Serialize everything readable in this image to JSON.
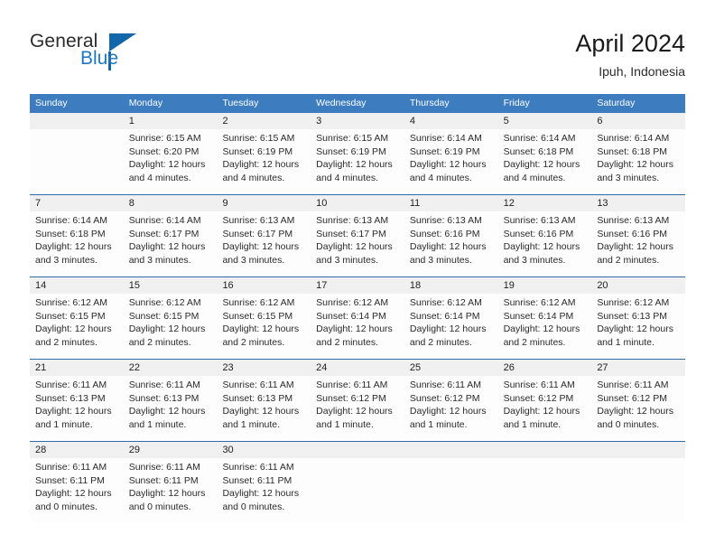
{
  "brand": {
    "name_part1": "General",
    "name_part2": "Blue",
    "accent_color": "#1366a8",
    "triangle_icon": "brand-triangle-icon"
  },
  "header": {
    "title": "April 2024",
    "subtitle": "Ipuh, Indonesia"
  },
  "calendar": {
    "header_bg": "#3d7dbf",
    "number_band_bg": "#f0f0f0",
    "week_divider_color": "#2f6ca8",
    "day_names": [
      "Sunday",
      "Monday",
      "Tuesday",
      "Wednesday",
      "Thursday",
      "Friday",
      "Saturday"
    ],
    "weeks": [
      {
        "days": [
          {
            "date": "",
            "lines": []
          },
          {
            "date": "1",
            "lines": [
              "Sunrise: 6:15 AM",
              "Sunset: 6:20 PM",
              "Daylight: 12 hours",
              "and 4 minutes."
            ]
          },
          {
            "date": "2",
            "lines": [
              "Sunrise: 6:15 AM",
              "Sunset: 6:19 PM",
              "Daylight: 12 hours",
              "and 4 minutes."
            ]
          },
          {
            "date": "3",
            "lines": [
              "Sunrise: 6:15 AM",
              "Sunset: 6:19 PM",
              "Daylight: 12 hours",
              "and 4 minutes."
            ]
          },
          {
            "date": "4",
            "lines": [
              "Sunrise: 6:14 AM",
              "Sunset: 6:19 PM",
              "Daylight: 12 hours",
              "and 4 minutes."
            ]
          },
          {
            "date": "5",
            "lines": [
              "Sunrise: 6:14 AM",
              "Sunset: 6:18 PM",
              "Daylight: 12 hours",
              "and 4 minutes."
            ]
          },
          {
            "date": "6",
            "lines": [
              "Sunrise: 6:14 AM",
              "Sunset: 6:18 PM",
              "Daylight: 12 hours",
              "and 3 minutes."
            ]
          }
        ]
      },
      {
        "days": [
          {
            "date": "7",
            "lines": [
              "Sunrise: 6:14 AM",
              "Sunset: 6:18 PM",
              "Daylight: 12 hours",
              "and 3 minutes."
            ]
          },
          {
            "date": "8",
            "lines": [
              "Sunrise: 6:14 AM",
              "Sunset: 6:17 PM",
              "Daylight: 12 hours",
              "and 3 minutes."
            ]
          },
          {
            "date": "9",
            "lines": [
              "Sunrise: 6:13 AM",
              "Sunset: 6:17 PM",
              "Daylight: 12 hours",
              "and 3 minutes."
            ]
          },
          {
            "date": "10",
            "lines": [
              "Sunrise: 6:13 AM",
              "Sunset: 6:17 PM",
              "Daylight: 12 hours",
              "and 3 minutes."
            ]
          },
          {
            "date": "11",
            "lines": [
              "Sunrise: 6:13 AM",
              "Sunset: 6:16 PM",
              "Daylight: 12 hours",
              "and 3 minutes."
            ]
          },
          {
            "date": "12",
            "lines": [
              "Sunrise: 6:13 AM",
              "Sunset: 6:16 PM",
              "Daylight: 12 hours",
              "and 3 minutes."
            ]
          },
          {
            "date": "13",
            "lines": [
              "Sunrise: 6:13 AM",
              "Sunset: 6:16 PM",
              "Daylight: 12 hours",
              "and 2 minutes."
            ]
          }
        ]
      },
      {
        "days": [
          {
            "date": "14",
            "lines": [
              "Sunrise: 6:12 AM",
              "Sunset: 6:15 PM",
              "Daylight: 12 hours",
              "and 2 minutes."
            ]
          },
          {
            "date": "15",
            "lines": [
              "Sunrise: 6:12 AM",
              "Sunset: 6:15 PM",
              "Daylight: 12 hours",
              "and 2 minutes."
            ]
          },
          {
            "date": "16",
            "lines": [
              "Sunrise: 6:12 AM",
              "Sunset: 6:15 PM",
              "Daylight: 12 hours",
              "and 2 minutes."
            ]
          },
          {
            "date": "17",
            "lines": [
              "Sunrise: 6:12 AM",
              "Sunset: 6:14 PM",
              "Daylight: 12 hours",
              "and 2 minutes."
            ]
          },
          {
            "date": "18",
            "lines": [
              "Sunrise: 6:12 AM",
              "Sunset: 6:14 PM",
              "Daylight: 12 hours",
              "and 2 minutes."
            ]
          },
          {
            "date": "19",
            "lines": [
              "Sunrise: 6:12 AM",
              "Sunset: 6:14 PM",
              "Daylight: 12 hours",
              "and 2 minutes."
            ]
          },
          {
            "date": "20",
            "lines": [
              "Sunrise: 6:12 AM",
              "Sunset: 6:13 PM",
              "Daylight: 12 hours",
              "and 1 minute."
            ]
          }
        ]
      },
      {
        "days": [
          {
            "date": "21",
            "lines": [
              "Sunrise: 6:11 AM",
              "Sunset: 6:13 PM",
              "Daylight: 12 hours",
              "and 1 minute."
            ]
          },
          {
            "date": "22",
            "lines": [
              "Sunrise: 6:11 AM",
              "Sunset: 6:13 PM",
              "Daylight: 12 hours",
              "and 1 minute."
            ]
          },
          {
            "date": "23",
            "lines": [
              "Sunrise: 6:11 AM",
              "Sunset: 6:13 PM",
              "Daylight: 12 hours",
              "and 1 minute."
            ]
          },
          {
            "date": "24",
            "lines": [
              "Sunrise: 6:11 AM",
              "Sunset: 6:12 PM",
              "Daylight: 12 hours",
              "and 1 minute."
            ]
          },
          {
            "date": "25",
            "lines": [
              "Sunrise: 6:11 AM",
              "Sunset: 6:12 PM",
              "Daylight: 12 hours",
              "and 1 minute."
            ]
          },
          {
            "date": "26",
            "lines": [
              "Sunrise: 6:11 AM",
              "Sunset: 6:12 PM",
              "Daylight: 12 hours",
              "and 1 minute."
            ]
          },
          {
            "date": "27",
            "lines": [
              "Sunrise: 6:11 AM",
              "Sunset: 6:12 PM",
              "Daylight: 12 hours",
              "and 0 minutes."
            ]
          }
        ]
      },
      {
        "days": [
          {
            "date": "28",
            "lines": [
              "Sunrise: 6:11 AM",
              "Sunset: 6:11 PM",
              "Daylight: 12 hours",
              "and 0 minutes."
            ]
          },
          {
            "date": "29",
            "lines": [
              "Sunrise: 6:11 AM",
              "Sunset: 6:11 PM",
              "Daylight: 12 hours",
              "and 0 minutes."
            ]
          },
          {
            "date": "30",
            "lines": [
              "Sunrise: 6:11 AM",
              "Sunset: 6:11 PM",
              "Daylight: 12 hours",
              "and 0 minutes."
            ]
          },
          {
            "date": "",
            "lines": []
          },
          {
            "date": "",
            "lines": []
          },
          {
            "date": "",
            "lines": []
          },
          {
            "date": "",
            "lines": []
          }
        ]
      }
    ]
  }
}
